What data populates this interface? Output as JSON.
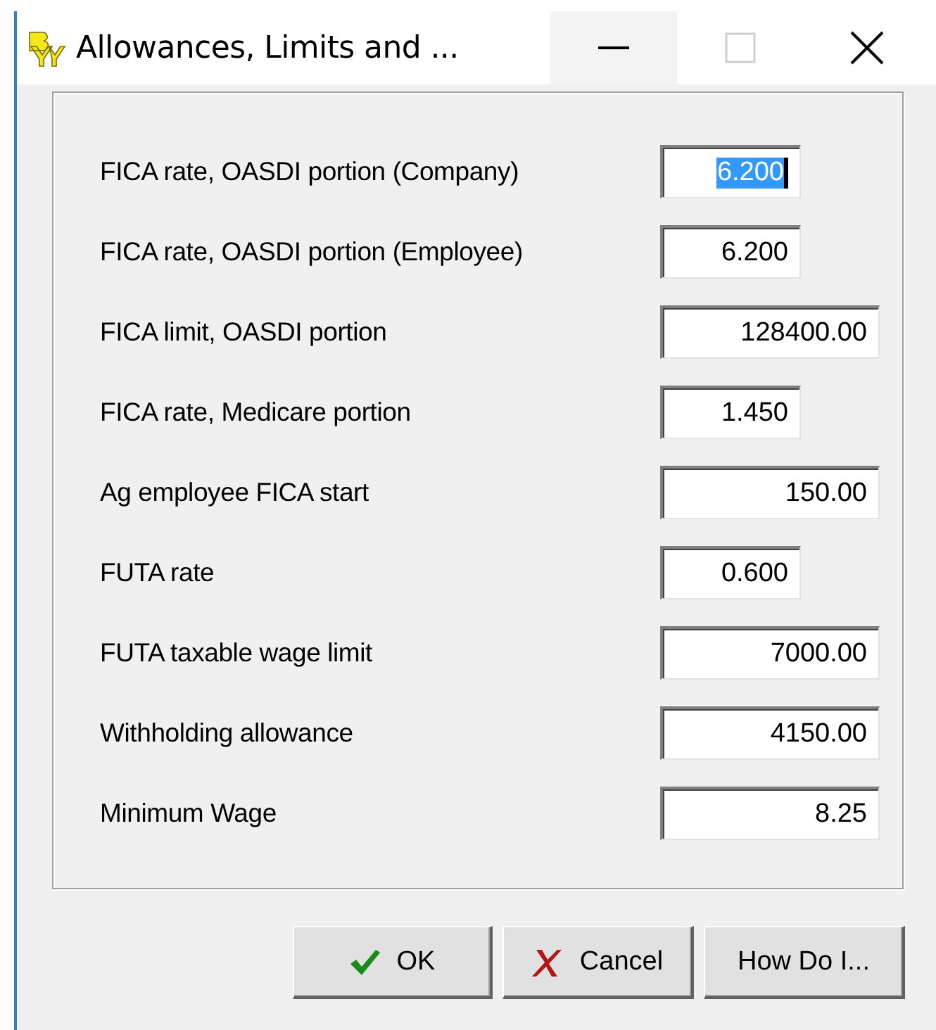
{
  "window": {
    "title": "Allowances, Limits and ...",
    "maximize_disabled": true
  },
  "fields": [
    {
      "label": "FICA rate, OASDI portion (Company)",
      "value": "6.200",
      "kind": "short",
      "selected": true
    },
    {
      "label": "FICA rate, OASDI portion (Employee)",
      "value": "6.200",
      "kind": "short",
      "selected": false
    },
    {
      "label": "FICA limit, OASDI portion",
      "value": "128400.00",
      "kind": "long",
      "selected": false
    },
    {
      "label": "FICA rate, Medicare portion",
      "value": "1.450",
      "kind": "short",
      "selected": false
    },
    {
      "label": "Ag employee FICA start",
      "value": "150.00",
      "kind": "long",
      "selected": false
    },
    {
      "label": "FUTA rate",
      "value": "0.600",
      "kind": "short",
      "selected": false
    },
    {
      "label": "FUTA taxable wage limit",
      "value": "7000.00",
      "kind": "long",
      "selected": false
    },
    {
      "label": "Withholding allowance",
      "value": "4150.00",
      "kind": "long",
      "selected": false
    },
    {
      "label": "Minimum Wage",
      "value": "8.25",
      "kind": "long",
      "selected": false
    }
  ],
  "buttons": [
    {
      "label": "OK",
      "kind": "ok"
    },
    {
      "label": "Cancel",
      "kind": "cancel"
    },
    {
      "label": "How Do I...",
      "kind": "help"
    }
  ]
}
